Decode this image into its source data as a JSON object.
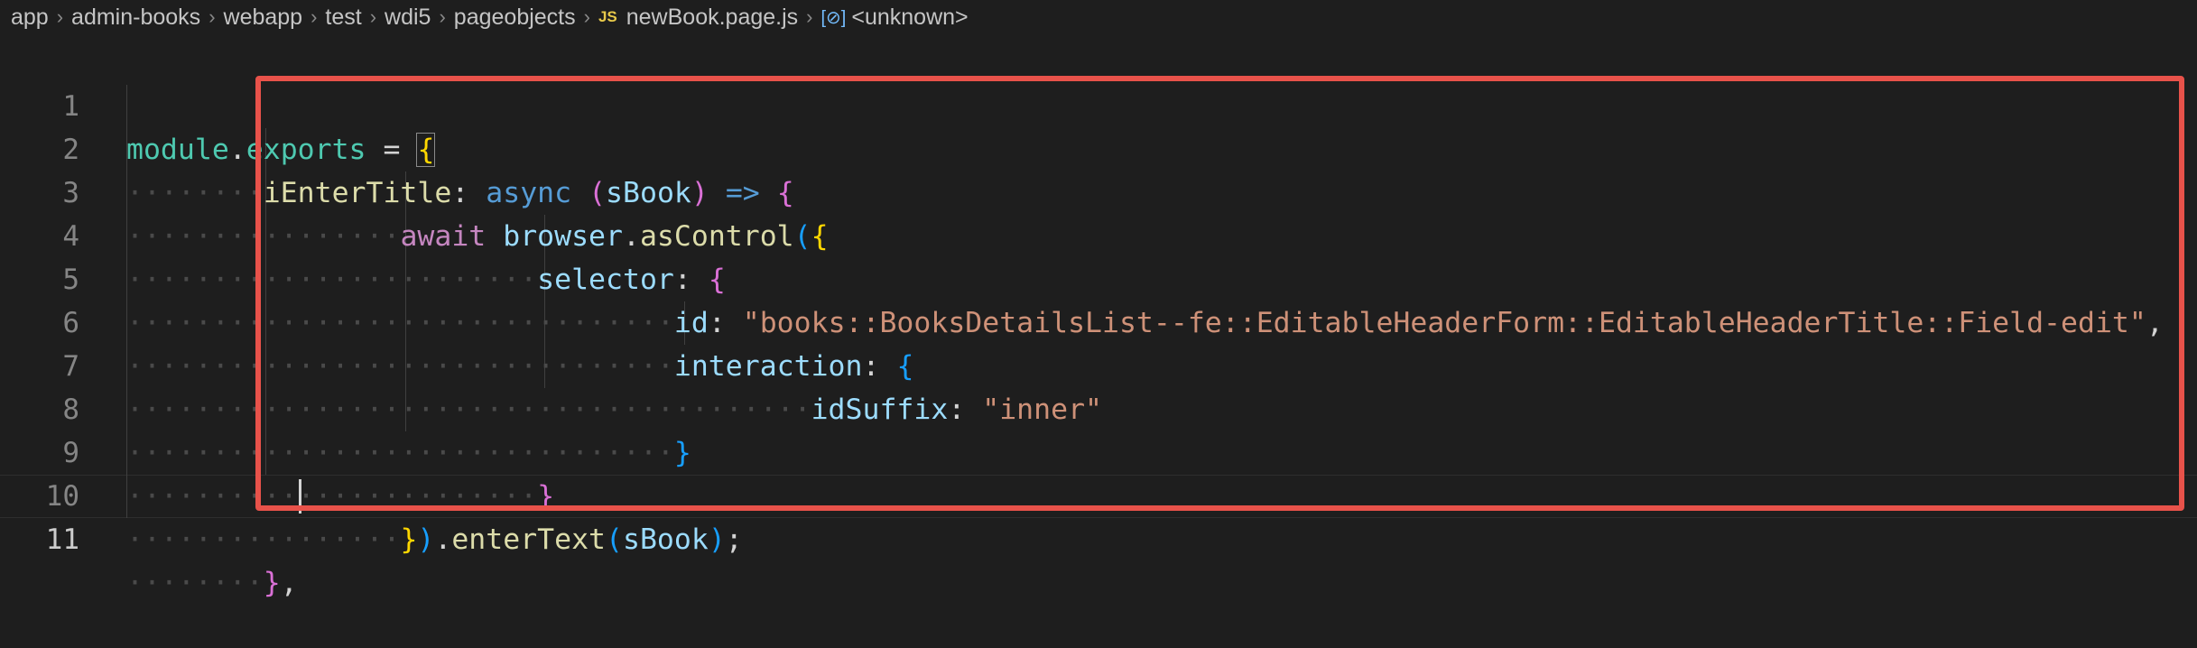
{
  "breadcrumb": {
    "items": [
      "app",
      "admin-books",
      "webapp",
      "test",
      "wdi5",
      "pageobjects"
    ],
    "file_icon": "JS",
    "file": "newBook.page.js",
    "symbol_icon": "symbol-namespace-icon",
    "symbol": "<unknown>"
  },
  "editor": {
    "line_numbers": [
      "1",
      "2",
      "3",
      "4",
      "5",
      "6",
      "7",
      "8",
      "9",
      "10",
      "11"
    ],
    "active_line": 11,
    "tokens": {
      "module": "module",
      "dot": ".",
      "exports": "exports",
      "eq": " = ",
      "brace_open": "{",
      "iEnterTitle": "iEnterTitle",
      "colon": ":",
      "async": "async",
      "paren_open": "(",
      "sBook": "sBook",
      "paren_close": ")",
      "arrow": "=>",
      "await": "await",
      "browser": "browser",
      "asControl": "asControl",
      "selector": "selector",
      "id": "id",
      "id_value": "\"books::BooksDetailsList--fe::EditableHeaderForm::EditableHeaderTitle::Field-edit\"",
      "comma": ",",
      "interaction": "interaction",
      "idSuffix": "idSuffix",
      "idSuffix_value": "\"inner\"",
      "brace_close": "}",
      "enterText": "enterText",
      "semicolon": ";"
    }
  },
  "colors": {
    "highlight_box": "#e8524a",
    "background": "#1e1e1e"
  }
}
